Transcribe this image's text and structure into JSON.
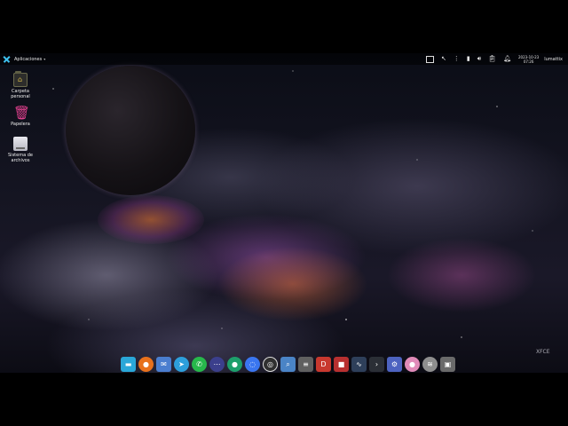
{
  "panel": {
    "menu_label": "Aplicaciones",
    "clock_date": "2023-10-23",
    "clock_time": "07:26",
    "user": "lumattix",
    "tray_icons": [
      "workspace-switcher-icon",
      "cursor-icon",
      "network-icon",
      "battery-icon",
      "volume-icon",
      "clipboard-icon",
      "notifications-icon"
    ]
  },
  "desktop_icons": [
    {
      "name": "home-folder",
      "label_1": "Carpeta",
      "label_2": "personal",
      "icon": "home-folder-icon"
    },
    {
      "name": "trash",
      "label_1": "Papelera",
      "icon": "trash-icon"
    },
    {
      "name": "filesystem",
      "label_1": "Sistema de",
      "label_2": "archivos",
      "icon": "drive-icon"
    }
  ],
  "dock_items": [
    {
      "name": "files",
      "icon": "folder-icon",
      "color": "#2aa7d8"
    },
    {
      "name": "firefox",
      "icon": "firefox-icon",
      "color": "#e8711c"
    },
    {
      "name": "mail",
      "icon": "mail-icon",
      "color": "#4a7ecf"
    },
    {
      "name": "telegram",
      "icon": "telegram-icon",
      "color": "#2d9fdb"
    },
    {
      "name": "whatsapp",
      "icon": "whatsapp-icon",
      "color": "#27b84b"
    },
    {
      "name": "dots-app",
      "icon": "dots-icon",
      "color": "#3b3f8c"
    },
    {
      "name": "chat",
      "icon": "chat-icon",
      "color": "#1d9f6b"
    },
    {
      "name": "signal",
      "icon": "signal-icon",
      "color": "#3a76f0"
    },
    {
      "name": "obs",
      "icon": "obs-icon",
      "color": "#303030"
    },
    {
      "name": "search",
      "icon": "magnifier-icon",
      "color": "#4a84c6"
    },
    {
      "name": "terminal-stack",
      "icon": "stack-icon",
      "color": "#606060"
    },
    {
      "name": "dc-app",
      "icon": "dc-icon",
      "color": "#c8382e"
    },
    {
      "name": "red-app",
      "icon": "box-icon",
      "color": "#b83030"
    },
    {
      "name": "monitor",
      "icon": "monitor-icon",
      "color": "#2e3f5a"
    },
    {
      "name": "terminal",
      "icon": "terminal-icon",
      "color": "#2b2f36"
    },
    {
      "name": "settings",
      "icon": "gear-icon",
      "color": "#4d63c0"
    },
    {
      "name": "pink-app",
      "icon": "circle-icon",
      "color": "#e08ab8"
    },
    {
      "name": "audio",
      "icon": "waveform-icon",
      "color": "#8e8e8e"
    },
    {
      "name": "window",
      "icon": "window-frame-icon",
      "color": "#6a6a6a"
    }
  ],
  "watermark": "XFCE"
}
